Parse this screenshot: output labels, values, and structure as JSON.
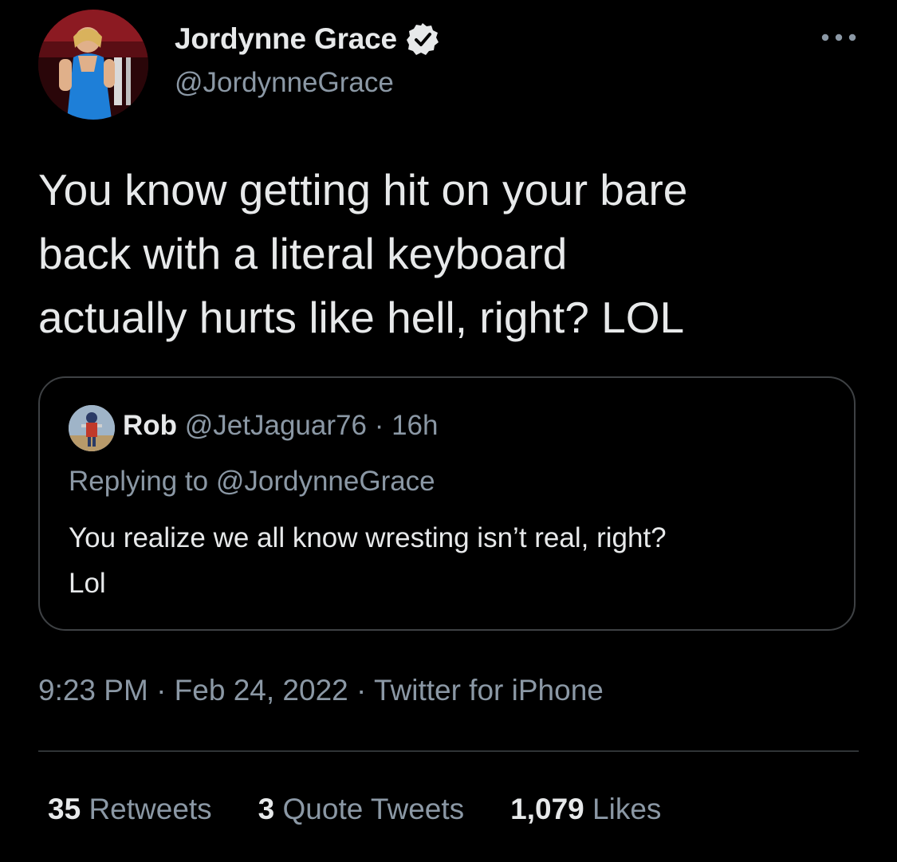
{
  "tweet": {
    "display_name": "Jordynne Grace",
    "handle": "@JordynneGrace",
    "verified": true,
    "text": "You know getting hit on your bare\nback with a literal keyboard\nactually hurts like hell, right? LOL",
    "timestamp": "9:23 PM · Feb 24, 2022 · Twitter for iPhone"
  },
  "quote": {
    "name": "Rob",
    "handle": "@JetJaguar76",
    "separator": "·",
    "age": "16h",
    "replying_to": "Replying to @JordynneGrace",
    "text": "You realize we all know wresting isn’t real, right?\nLol"
  },
  "stats": {
    "retweets_count": "35",
    "retweets_label": "Retweets",
    "quotes_count": "3",
    "quotes_label": "Quote Tweets",
    "likes_count": "1,079",
    "likes_label": "Likes"
  },
  "icons": {
    "verified": "verified-badge-icon",
    "more": "more-options-icon"
  },
  "colors": {
    "background": "#000000",
    "text_primary": "#e7e9ea",
    "text_secondary": "#8b98a5",
    "border": "#3e4144"
  }
}
